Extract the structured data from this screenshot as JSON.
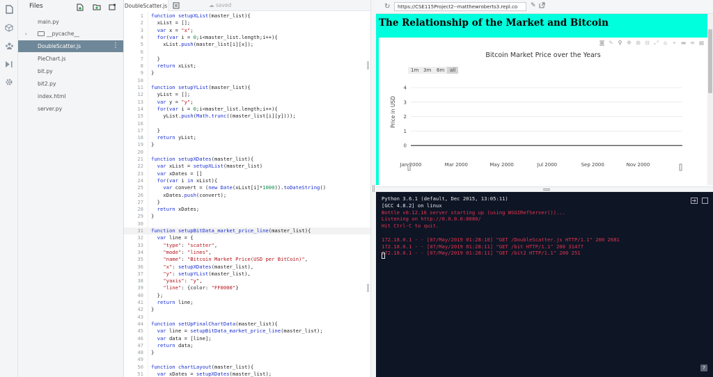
{
  "files_panel": {
    "title": "Files",
    "items": [
      {
        "name": "main.py",
        "type": "file",
        "selected": false
      },
      {
        "name": "__pycache__",
        "type": "folder",
        "selected": false
      },
      {
        "name": "DoubleScatter.js",
        "type": "file",
        "selected": true
      },
      {
        "name": "PieChart.js",
        "type": "file",
        "selected": false
      },
      {
        "name": "bit.py",
        "type": "file",
        "selected": false
      },
      {
        "name": "bit2.py",
        "type": "file",
        "selected": false
      },
      {
        "name": "index.html",
        "type": "file",
        "selected": false
      },
      {
        "name": "server.py",
        "type": "file",
        "selected": false
      }
    ]
  },
  "editor": {
    "tab_label": "DoubleScatter.js",
    "status": "saved",
    "current_line": 31,
    "lines": [
      "function setupXList(master_list){",
      "  xList = [];",
      "  var x = \"x\";",
      "  for(var i = 0;i<master_list.length;i++){",
      "    xList.push(master_list[i][x]);",
      "",
      "  }",
      "  return xList;",
      "}",
      "",
      "function setupYList(master_list){",
      "  yList = [];",
      "  var y = \"y\";",
      "  for(var i = 0;i<master_list.length;i++){",
      "    yList.push(Math.trunc((master_list[i][y])));",
      "",
      "  }",
      "  return yList;",
      "}",
      "",
      "function setupXDates(master_list){",
      "  var xList = setupXList(master_list)",
      "  var xDates = []",
      "  for(var i in xList){",
      "    var convert = (new Date(xList[i]*1000)).toDateString()",
      "    xDates.push(convert);",
      "  }",
      "  return xDates;",
      "}",
      "",
      "function setupBitData_market_price_line(master_list){",
      "  var line = {",
      "    \"type\": \"scatter\",",
      "    \"mode\": \"lines\",",
      "    \"name\": \"Bitcoin Market Price(USD per BitCoin)\",",
      "    \"x\": setupXDates(master_list),",
      "    \"y\": setupYList(master_list),",
      "    \"yaxis\": \"y\",",
      "    \"line\": {color: \"FF0000\"}",
      "  };",
      "  return line;",
      "}",
      "",
      "function setUpFinalChartData(master_list){",
      "  var line = setupBitData_market_price_line(master_list);",
      "  var data = [line];",
      "  return data;",
      "}",
      "",
      "function chartLayout(master_list){",
      "  var xDates = setupXDates(master_list);",
      "  var yList = setupYList(master_list);"
    ]
  },
  "browser": {
    "url": "https://CSE115Project2--matthewroberts3.repl.co",
    "page_title": "The Relationship of the Market and Bitcoin",
    "range_buttons": [
      "1m",
      "3m",
      "6m",
      "all"
    ],
    "active_range": "all"
  },
  "chart_data": {
    "type": "line",
    "title": "Bitcoin Market Price over the Years",
    "xlabel": "",
    "ylabel": "Price in USD",
    "x_ticks": [
      "Jan 2000",
      "Mar 2000",
      "May 2000",
      "Jul 2000",
      "Sep 2000",
      "Nov 2000"
    ],
    "y_ticks": [
      0,
      1,
      2,
      3,
      4
    ],
    "ylim": [
      -1,
      4
    ],
    "series": [
      {
        "color": "#444444",
        "x": [
          "Jan 2000",
          "Dec 2000"
        ],
        "y": [
          0,
          0
        ]
      }
    ],
    "legend": "none",
    "grid": true
  },
  "console": {
    "lines": [
      {
        "text": "Python 3.6.1 (default, Dec 2015, 13:05:11)",
        "color": "white"
      },
      {
        "text": "[GCC 4.8.2] on linux",
        "color": "white"
      },
      {
        "text": "Bottle v0.12.16 server starting up (using WSGIRefServer())...",
        "color": "red"
      },
      {
        "text": "Listening on http://0.0.0.0:8080/",
        "color": "red"
      },
      {
        "text": "Hit Ctrl-C to quit.",
        "color": "red"
      },
      {
        "text": "",
        "color": "white"
      },
      {
        "text": "172.18.0.1 - - [07/May/2019 01:28:10] \"GET /DoubleScatter.js HTTP/1.1\" 200 2681",
        "color": "red"
      },
      {
        "text": "172.18.0.1 - - [07/May/2019 01:28:11] \"GET /bit HTTP/1.1\" 200 31477",
        "color": "red"
      },
      {
        "text": "172.18.0.1 - - [07/May/2019 01:28:11] \"GET /bit2 HTTP/1.1\" 200 251",
        "color": "red"
      }
    ],
    "help_label": "?"
  },
  "colors": {
    "page_bg": "#00ffdd",
    "console_bg": "#0e1525",
    "selected_file": "#6f8899",
    "console_red": "#e3334f"
  }
}
